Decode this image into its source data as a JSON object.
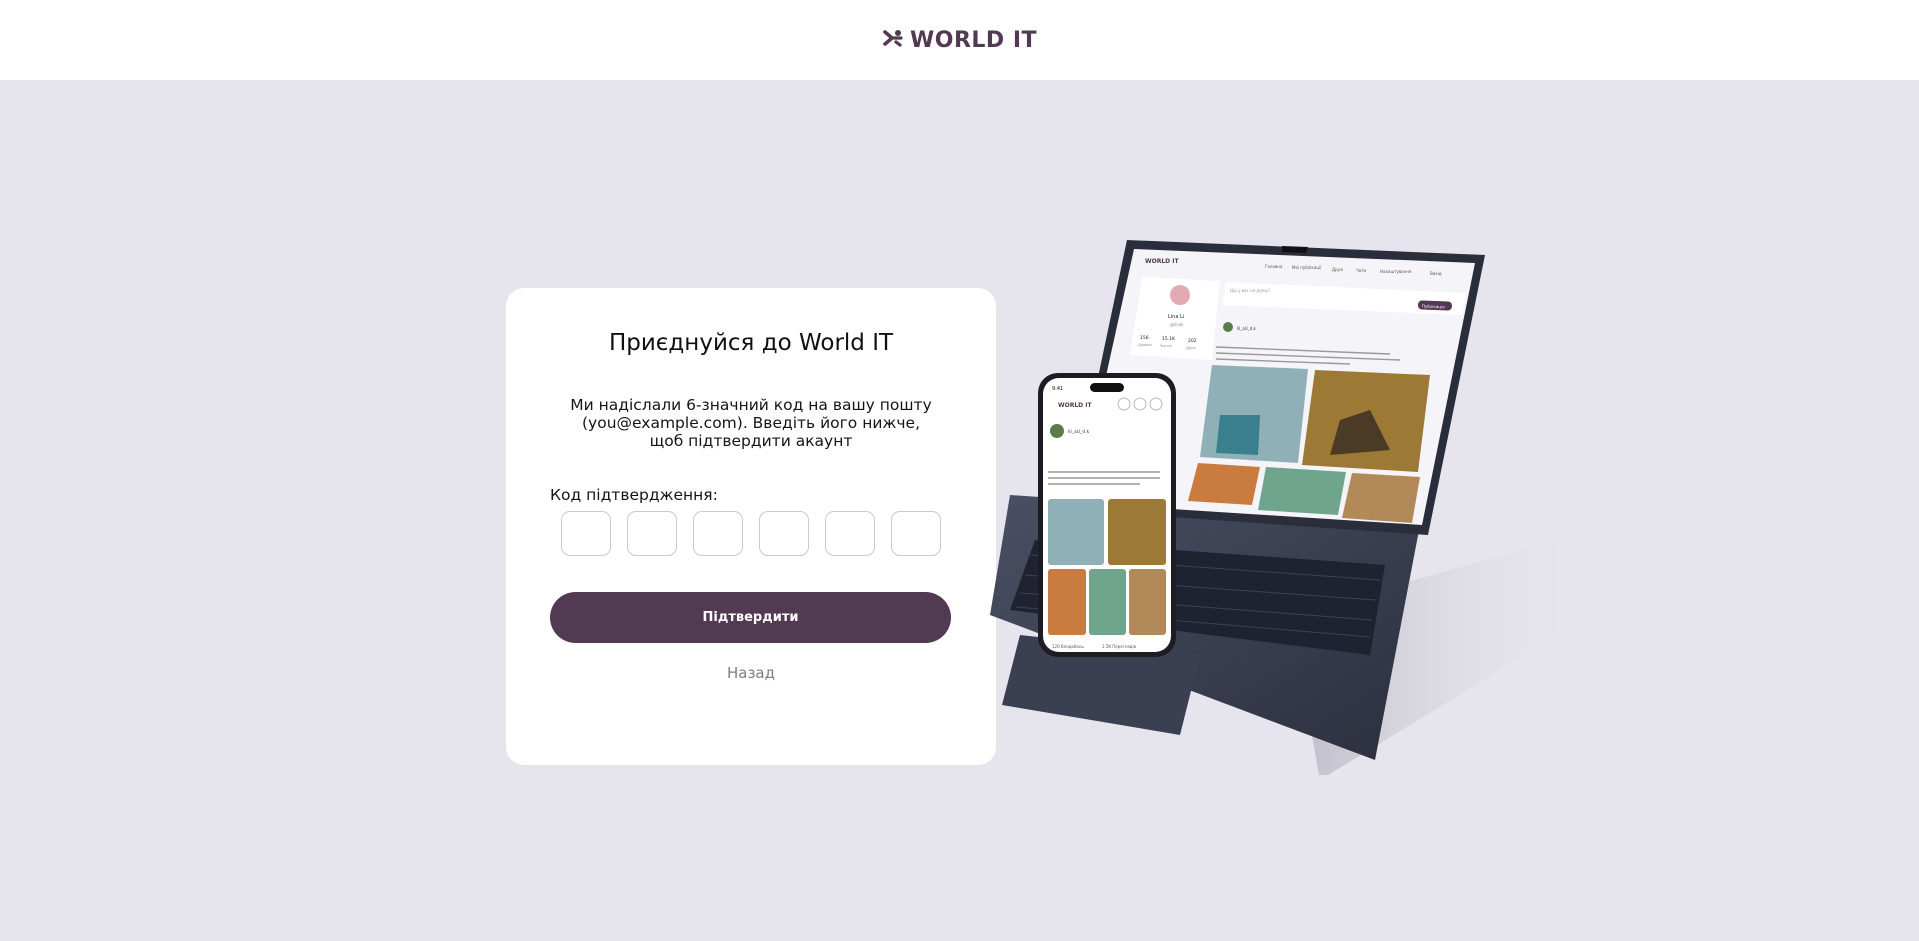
{
  "header": {
    "brand": "WORLD IT",
    "brand_color": "#523a52"
  },
  "verify": {
    "title": "Приєднуйся до World IT",
    "description": "Ми надіслали 6-значний код на вашу пошту (you@example.com). Введіть його нижче, щоб підтвердити акаунт",
    "code_label": "Код підтвердження:",
    "code_digits": [
      "",
      "",
      "",
      "",
      "",
      ""
    ],
    "confirm_label": "Підтвердити",
    "back_label": "Назад"
  },
  "illustration": {
    "laptop": {
      "brand": "WORLD IT",
      "nav": [
        "Головна",
        "Мої публікації",
        "Друзі",
        "Чати",
        "Налаштування",
        "Вихід"
      ],
      "search_placeholder": "Що у вас на думці?",
      "profile_name": "Lina Li",
      "profile_handle": "@linali",
      "stats": [
        {
          "value": "156",
          "label": "Дописи"
        },
        {
          "value": "15.1K",
          "label": "Читачі"
        },
        {
          "value": "202",
          "label": "Друзі"
        }
      ],
      "publish_label": "Публікація",
      "post_user": "lil_aU_d.k"
    },
    "phone": {
      "time": "9:41",
      "brand": "WORLD IT",
      "post_user": "lil_aU_d.k",
      "likes": "120 Вподобань",
      "views": "1.5K Переглядів"
    }
  },
  "colors": {
    "accent": "#523a52",
    "background": "#e6e4ec"
  }
}
